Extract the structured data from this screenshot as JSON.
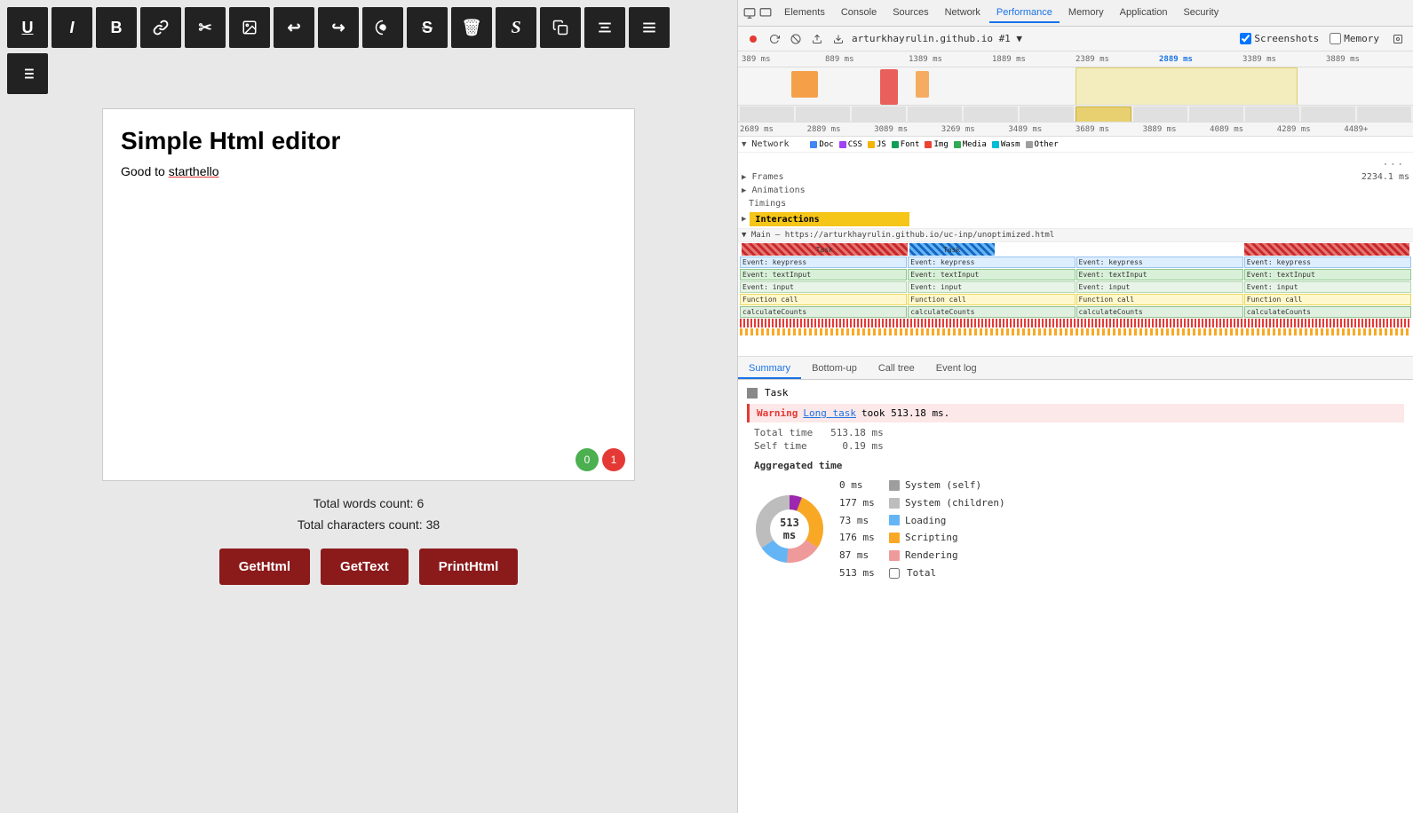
{
  "left": {
    "toolbar": [
      {
        "id": "underline",
        "label": "U̲",
        "icon": "underline-icon"
      },
      {
        "id": "italic",
        "label": "I",
        "icon": "italic-icon"
      },
      {
        "id": "bold",
        "label": "B",
        "icon": "bold-icon"
      },
      {
        "id": "link",
        "label": "🔗",
        "icon": "link-icon"
      },
      {
        "id": "cut",
        "label": "✂",
        "icon": "cut-icon"
      },
      {
        "id": "image",
        "label": "🖼",
        "icon": "image-icon"
      },
      {
        "id": "undo",
        "label": "↩",
        "icon": "undo-icon"
      },
      {
        "id": "redo",
        "label": "↪",
        "icon": "redo-icon"
      },
      {
        "id": "paint",
        "label": "🎨",
        "icon": "paint-icon"
      },
      {
        "id": "strikethrough",
        "label": "S̶",
        "icon": "strikethrough-icon"
      },
      {
        "id": "trash",
        "label": "🗑",
        "icon": "trash-icon"
      },
      {
        "id": "spellcheck",
        "label": "S",
        "icon": "spellcheck-icon"
      },
      {
        "id": "copy",
        "label": "⧉",
        "icon": "copy-icon"
      },
      {
        "id": "align-center",
        "label": "☰",
        "icon": "align-center-icon"
      },
      {
        "id": "align-justify",
        "label": "≡",
        "icon": "align-justify-icon"
      }
    ],
    "second_row": [
      {
        "id": "align2",
        "label": "☰",
        "icon": "align2-icon"
      }
    ],
    "editor": {
      "title": "Simple Html editor",
      "paragraph": "Good to ",
      "misspell_word": "starthello"
    },
    "badges": {
      "green": "0",
      "red": "1"
    },
    "stats": {
      "words": "Total words count: 6",
      "chars": "Total characters count: 38"
    },
    "buttons": {
      "gethtml": "GetHtml",
      "gettext": "GetText",
      "printhtml": "PrintHtml"
    }
  },
  "devtools": {
    "tabs": [
      {
        "label": "Elements",
        "active": false
      },
      {
        "label": "Console",
        "active": false
      },
      {
        "label": "Sources",
        "active": false
      },
      {
        "label": "Network",
        "active": false
      },
      {
        "label": "Performance",
        "active": true
      },
      {
        "label": "Memory",
        "active": false
      },
      {
        "label": "Application",
        "active": false
      },
      {
        "label": "Security",
        "active": false
      }
    ],
    "toolbar": {
      "url": "arturkhayrulin.github.io #1 ▼",
      "screenshots_label": "Screenshots",
      "memory_label": "Memory"
    },
    "ruler": {
      "marks": [
        "389 ms",
        "889 ms",
        "1389 ms",
        "1889 ms",
        "2389 ms",
        "2889 ms",
        "3389 ms",
        "3889 ms"
      ]
    },
    "ruler2": {
      "marks": [
        "2689 ms",
        "2889 ms",
        "3089 ms",
        "3269 ms",
        "3489 ms",
        "3689 ms",
        "3889 ms",
        "4089 ms",
        "4289 ms",
        "4489+"
      ]
    },
    "network_legend": [
      {
        "color": "#4285f4",
        "label": "Doc"
      },
      {
        "color": "#a142f4",
        "label": "CSS"
      },
      {
        "color": "#f4b400",
        "label": "JS"
      },
      {
        "color": "#0f9d58",
        "label": "Font"
      },
      {
        "color": "#ea4335",
        "label": "Img"
      },
      {
        "color": "#34a853",
        "label": "Media"
      },
      {
        "color": "#00bcd4",
        "label": "Wasm"
      },
      {
        "color": "#9e9e9e",
        "label": "Other"
      }
    ],
    "more_label": "...",
    "timeline": {
      "rows": [
        {
          "label": "Frames",
          "value": "2234.1 ms"
        },
        {
          "label": "Animations"
        },
        {
          "label": "Timings"
        }
      ]
    },
    "interactions_label": "Interactions",
    "main_label": "▼ Main — https://arturkhayrulin.github.io/uc-inp/unoptimized.html",
    "task_events": [
      "Event: keypress",
      "Event: keypress",
      "Event: keypress",
      "Event: keypress",
      "Event: textInput",
      "Event: textInput",
      "Event: textInput",
      "Event: textInput",
      "Event: input",
      "Event: input",
      "Event: input",
      "Event: input",
      "Function call",
      "Function call",
      "Function call",
      "Function call",
      "calculateCounts",
      "calculateCounts",
      "calculateCounts",
      "calculateCounts"
    ],
    "bottom_tabs": [
      {
        "label": "Summary",
        "active": true
      },
      {
        "label": "Bottom-up",
        "active": false
      },
      {
        "label": "Call tree",
        "active": false
      },
      {
        "label": "Event log",
        "active": false
      }
    ],
    "summary": {
      "task_label": "Task",
      "warning_label": "Warning",
      "long_task_link": "Long task",
      "long_task_text": "took 513.18 ms.",
      "total_time_label": "Total time",
      "total_time_value": "513.18 ms",
      "self_time_label": "Self time",
      "self_time_value": "0.19 ms",
      "aggregated_title": "Aggregated time",
      "donut_label": "513 ms",
      "legend": [
        {
          "color": "#9e9e9e",
          "value": "0 ms",
          "label": "System (self)"
        },
        {
          "color": "#bdbdbd",
          "value": "177 ms",
          "label": "System (children)"
        },
        {
          "color": "#64b5f6",
          "value": "73 ms",
          "label": "Loading"
        },
        {
          "color": "#f9a825",
          "value": "176 ms",
          "label": "Scripting"
        },
        {
          "color": "#ef9a9a",
          "value": "87 ms",
          "label": "Rendering"
        },
        {
          "value": "513 ms",
          "label": "Total",
          "is_total": true
        }
      ]
    }
  }
}
